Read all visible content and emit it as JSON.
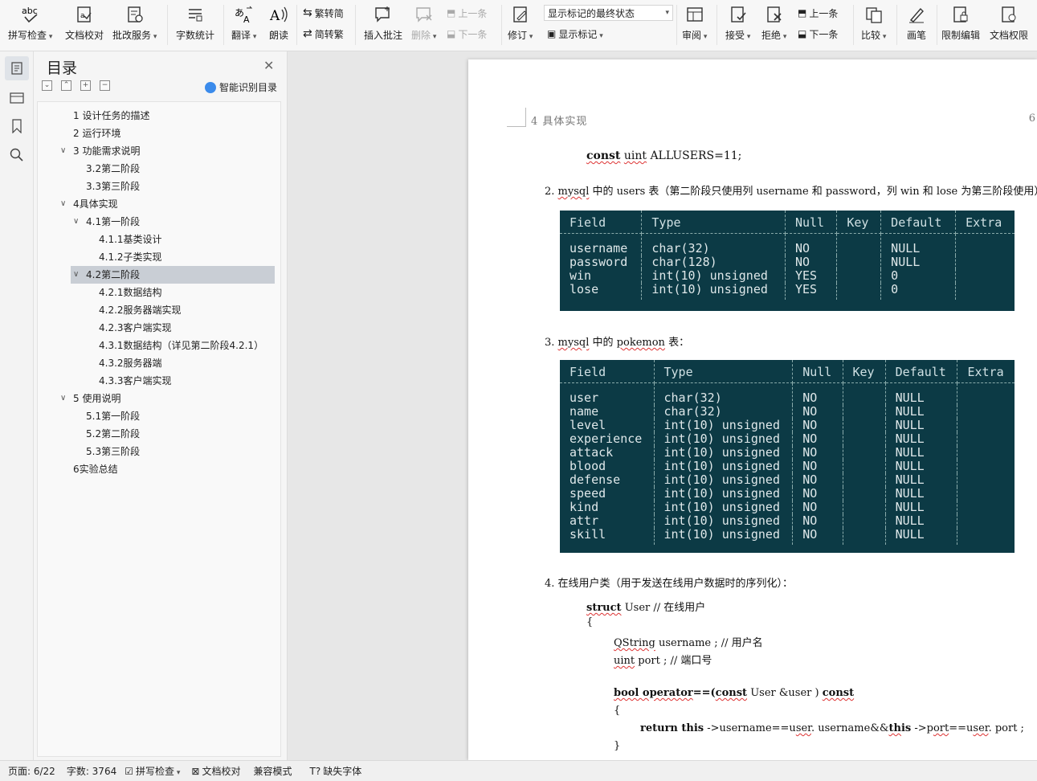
{
  "ribbon": {
    "spell_check": "拼写检查",
    "doc_proof": "文档校对",
    "batch_service": "批改服务",
    "word_count": "字数统计",
    "translate": "翻译",
    "read_aloud": "朗读",
    "trad_to_simp": "繁转简",
    "simp_to_trad": "简转繁",
    "insert_comment": "插入批注",
    "delete": "删除",
    "prev_comment": "上一条",
    "next_comment": "下一条",
    "revise": "修订",
    "markup_mode": "显示标记的最终状态",
    "show_markup": "显示标记",
    "review": "审阅",
    "accept": "接受",
    "reject": "拒绝",
    "prev_change": "上一条",
    "next_change": "下一条",
    "compare": "比较",
    "pen": "画笔",
    "restrict_edit": "限制编辑",
    "doc_rights": "文档权限"
  },
  "toc": {
    "title": "目录",
    "smart_label": "智能识别目录",
    "items": [
      {
        "label": "1 设计任务的描述"
      },
      {
        "label": "2 运行环境"
      },
      {
        "label": "3 功能需求说明"
      },
      {
        "label": "3.2第二阶段"
      },
      {
        "label": "3.3第三阶段"
      },
      {
        "label": "4具体实现"
      },
      {
        "label": "4.1第一阶段"
      },
      {
        "label": "4.1.1基类设计"
      },
      {
        "label": "4.1.2子类实现"
      },
      {
        "label": "4.2第二阶段"
      },
      {
        "label": "4.2.1数据结构"
      },
      {
        "label": "4.2.2服务器端实现"
      },
      {
        "label": "4.2.3客户端实现"
      },
      {
        "label": "4.3.1数据结构（详见第二阶段4.2.1）"
      },
      {
        "label": "4.3.2服务器端"
      },
      {
        "label": "4.3.3客户端实现"
      },
      {
        "label": "5 使用说明"
      },
      {
        "label": "5.1第一阶段"
      },
      {
        "label": "5.2第二阶段"
      },
      {
        "label": "5.3第三阶段"
      },
      {
        "label": "6实验总结"
      }
    ]
  },
  "doc": {
    "header_title": "4  具体实现",
    "header_page": "6",
    "line_const_kw": "const",
    "line_const_type": "uint",
    "line_const_rest": "ALLUSERS=11;",
    "item2_num": "2.",
    "item2_mysql": "mysql",
    "item2_text": "中的 users 表（第二阶段只使用列 username 和 password，列 win 和 lose 为第三阶段使用）",
    "item3_num": "3.",
    "item3_mysql": "mysql",
    "item3_mid": "中的",
    "item3_pokemon": "pokemon",
    "item3_end": "表：",
    "item4_num": "4.",
    "item4_text": "在线用户类（用于发送在线用户数据时的序列化）：",
    "code1_kw": "struct",
    "code1_rest": "User // 在线用户",
    "code2": "{",
    "code3_type": "QString",
    "code3_rest": "username ; // 用户名",
    "code4_type": "uint",
    "code4_rest": "port ; // 端口号",
    "code5_a": "bool operator",
    "code5_b": "==(",
    "code5_c": "const",
    "code5_d": "User &user )",
    "code5_e": "const",
    "code6": "{",
    "code7_a": "return this",
    "code7_b": "->username==u",
    "code7_c": "ser",
    "code7_d": ". username&&",
    "code7_e": "th",
    "code7_f": "is",
    "code7_g": "->p",
    "code7_h": "ort",
    "code7_i": "==u",
    "code7_j": "ser",
    "code7_k": ". port ;",
    "code8": "}"
  },
  "users_table": {
    "headers": [
      "Field",
      "Type",
      "Null",
      "Key",
      "Default",
      "Extra"
    ],
    "rows": [
      [
        "username",
        "char(32)",
        "NO",
        "",
        "NULL",
        ""
      ],
      [
        "password",
        "char(128)",
        "NO",
        "",
        "NULL",
        ""
      ],
      [
        "win",
        "int(10) unsigned",
        "YES",
        "",
        "0",
        ""
      ],
      [
        "lose",
        "int(10) unsigned",
        "YES",
        "",
        "0",
        ""
      ]
    ]
  },
  "pokemon_table": {
    "headers": [
      "Field",
      "Type",
      "Null",
      "Key",
      "Default",
      "Extra"
    ],
    "rows": [
      [
        "user",
        "char(32)",
        "NO",
        "",
        "NULL",
        ""
      ],
      [
        "name",
        "char(32)",
        "NO",
        "",
        "NULL",
        ""
      ],
      [
        "level",
        "int(10) unsigned",
        "NO",
        "",
        "NULL",
        ""
      ],
      [
        "experience",
        "int(10) unsigned",
        "NO",
        "",
        "NULL",
        ""
      ],
      [
        "attack",
        "int(10) unsigned",
        "NO",
        "",
        "NULL",
        ""
      ],
      [
        "blood",
        "int(10) unsigned",
        "NO",
        "",
        "NULL",
        ""
      ],
      [
        "defense",
        "int(10) unsigned",
        "NO",
        "",
        "NULL",
        ""
      ],
      [
        "speed",
        "int(10) unsigned",
        "NO",
        "",
        "NULL",
        ""
      ],
      [
        "kind",
        "int(10) unsigned",
        "NO",
        "",
        "NULL",
        ""
      ],
      [
        "attr",
        "int(10) unsigned",
        "NO",
        "",
        "NULL",
        ""
      ],
      [
        "skill",
        "int(10) unsigned",
        "NO",
        "",
        "NULL",
        ""
      ]
    ]
  },
  "status": {
    "page": "页面: 6/22",
    "words": "字数: 3764",
    "spell": "拼写检查",
    "proof": "文档校对",
    "compat": "兼容模式",
    "missing_font": "缺失字体"
  }
}
